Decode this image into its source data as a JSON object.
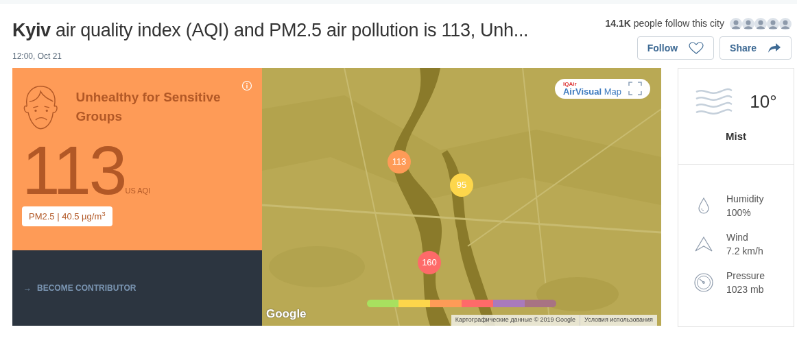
{
  "header": {
    "title": "**Kyiv** air quality index (AQI) and PM2.5 air pollution is 113, Unh...",
    "timestamp": "12:00, Oct 21",
    "followers": "**14.1K** people follow this city",
    "buttons": [
      {
        "kind": "follow",
        "label": "Follow"
      },
      {
        "kind": "share",
        "label": "Share"
      }
    ]
  },
  "aqi_panel": {
    "category": "Unhealthy for Sensitive Groups",
    "value": "113",
    "unit": "US AQI",
    "pollutant": "PM2.5 | 40.5 µg/m$^{3}$",
    "color": "#fe9b57",
    "contributor_link": "BECOME CONTRIBUTOR",
    "arrow": "→"
  },
  "map": {
    "badge_brand": "IQAir",
    "badge_title": "**AirVisual** Map",
    "markers": [
      {
        "value": "113",
        "color": "#fe9b57"
      },
      {
        "value": "95",
        "color": "#fdd64b"
      },
      {
        "value": "160",
        "color": "#fe6a69"
      }
    ],
    "legend": [
      {
        "color": "#a8e05f"
      },
      {
        "color": "#fdd64b"
      },
      {
        "color": "#fe9b57"
      },
      {
        "color": "#fe6a69"
      },
      {
        "color": "#a97abc"
      },
      {
        "color": "#a87383"
      }
    ],
    "logo": "Google",
    "attribution": "Картографические данные © 2019 Google",
    "terms": "Условия использования"
  },
  "weather": {
    "temperature": "10°",
    "condition": "Mist",
    "details": [
      {
        "kind": "humidity",
        "label": "Humidity",
        "value": "100%"
      },
      {
        "kind": "wind",
        "label": "Wind",
        "value": "7.2 km/h"
      },
      {
        "kind": "pressure",
        "label": "Pressure",
        "value": "1023 mb"
      }
    ]
  }
}
